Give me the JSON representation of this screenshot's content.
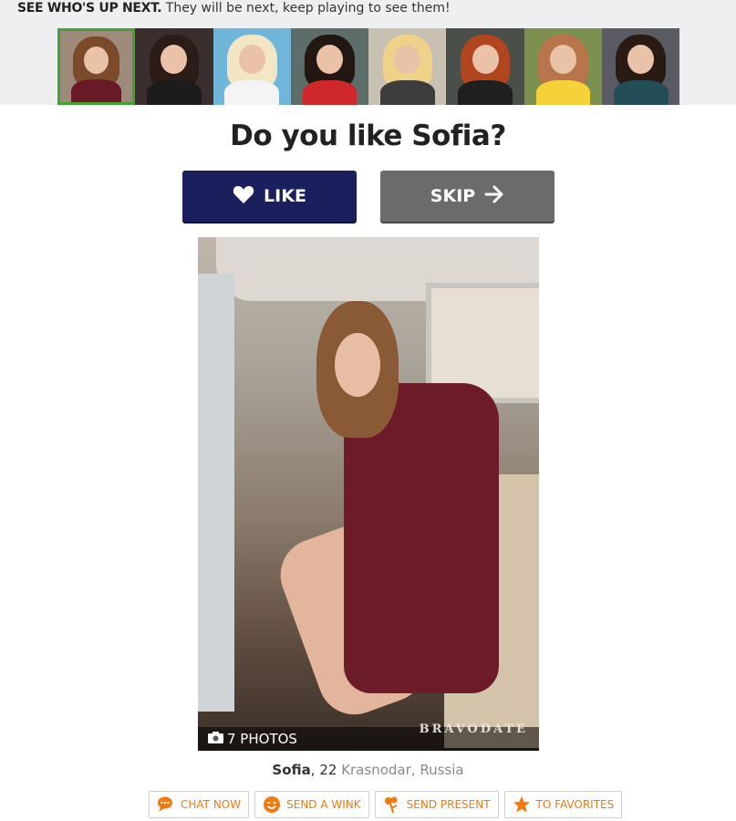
{
  "header": {
    "bold_text": "SEE WHO'S UP NEXT.",
    "text": " They will be next, keep playing to see them!"
  },
  "thumbnails": [
    {
      "hair": "#7a4a2a",
      "bg": "#9e8a7a",
      "body": "#6a1a27",
      "active": true
    },
    {
      "hair": "#2b1c17",
      "bg": "#3a2e2e",
      "body": "#1e1b1c"
    },
    {
      "hair": "#f2e6c4",
      "bg": "#6fb6da",
      "body": "#f4f4f4"
    },
    {
      "hair": "#221712",
      "bg": "#5c6d6a",
      "body": "#d0282a"
    },
    {
      "hair": "#f0d189",
      "bg": "#c9c0b4",
      "body": "#3c3c3c"
    },
    {
      "hair": "#b1451f",
      "bg": "#4a4f4a",
      "body": "#1f1f1f"
    },
    {
      "hair": "#b8744a",
      "bg": "#7b8f4e",
      "body": "#f6d23a"
    },
    {
      "hair": "#2a1a14",
      "bg": "#5a5a62",
      "body": "#234e57"
    }
  ],
  "question": "Do you like Sofia?",
  "buttons": {
    "like": "LIKE",
    "skip": "SKIP"
  },
  "photo": {
    "count_label": "7 PHOTOS",
    "watermark": "BRAVODATE"
  },
  "profile": {
    "name": "Sofia",
    "age": " 22",
    "location": "Krasnodar, Russia"
  },
  "actions": [
    {
      "label": "CHAT NOW",
      "icon": "chat-icon"
    },
    {
      "label": "SEND A WINK",
      "icon": "wink-icon"
    },
    {
      "label": "SEND PRESENT",
      "icon": "present-icon"
    },
    {
      "label": "TO FAVORITES",
      "icon": "star-icon"
    }
  ],
  "colors": {
    "accent": "#f07a0f",
    "like": "#1b1f5e",
    "skip": "#6b6b6b",
    "active_thumb": "#3fa332"
  }
}
